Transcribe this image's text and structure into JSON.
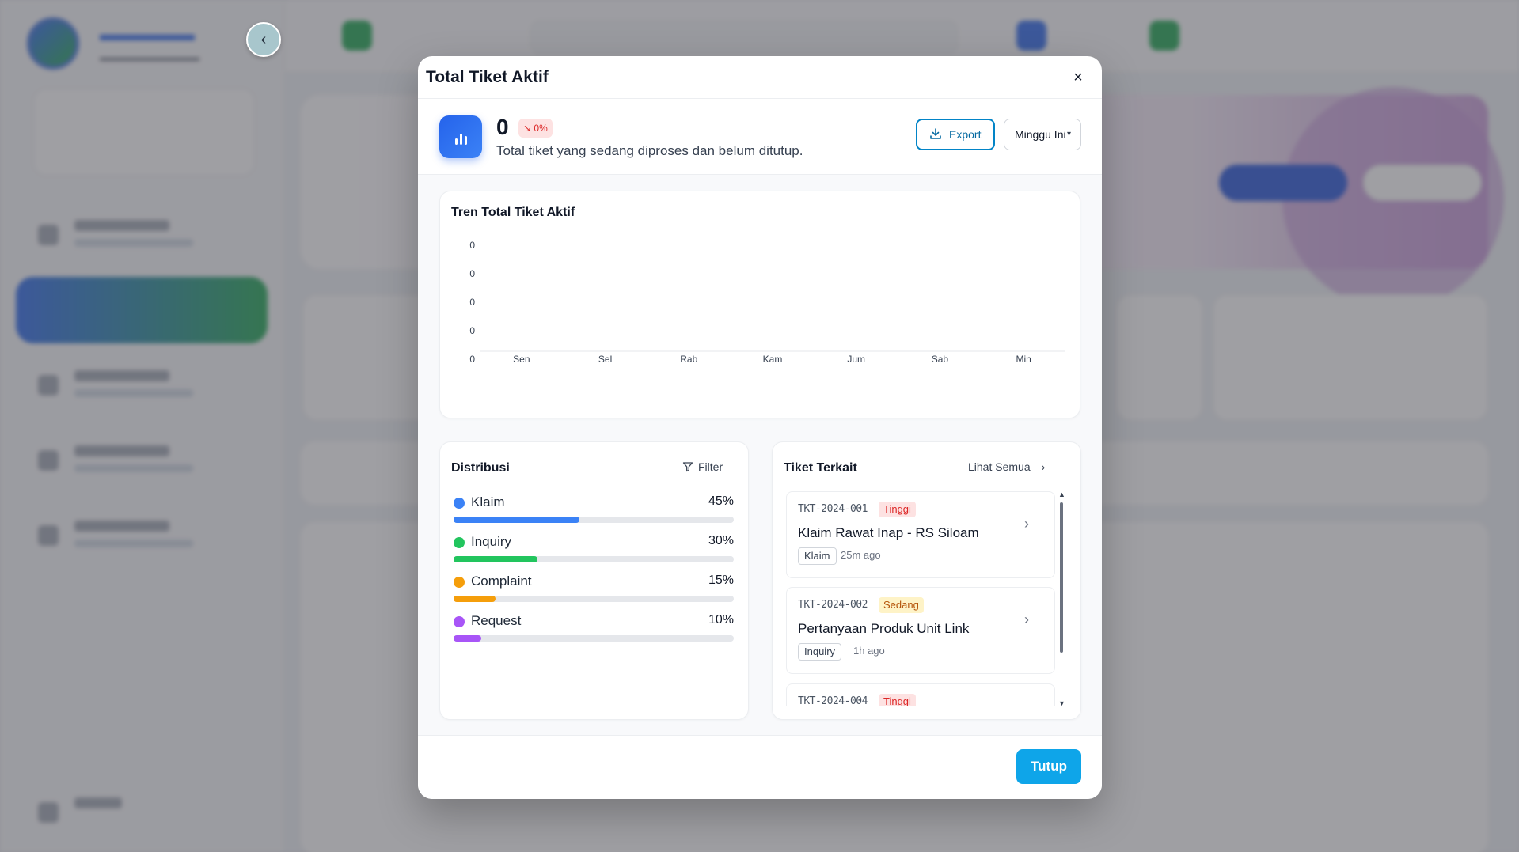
{
  "modal": {
    "title": "Total Tiket Aktif",
    "close_glyph": "×",
    "summary": {
      "value": "0",
      "change_badge": "↘ 0%",
      "description": "Total tiket yang sedang diproses dan belum ditutup.",
      "export_label": "Export",
      "period_label": "Minggu Ini"
    },
    "trend": {
      "title": "Tren Total Tiket Aktif"
    },
    "distribution": {
      "title": "Distribusi",
      "filter_label": "Filter",
      "items": [
        {
          "label": "Klaim",
          "percent": "45%",
          "value": 45,
          "color": "#3b82f6"
        },
        {
          "label": "Inquiry",
          "percent": "30%",
          "value": 30,
          "color": "#22c55e"
        },
        {
          "label": "Complaint",
          "percent": "15%",
          "value": 15,
          "color": "#f59e0b"
        },
        {
          "label": "Request",
          "percent": "10%",
          "value": 10,
          "color": "#a855f7"
        }
      ]
    },
    "related": {
      "title": "Tiket Terkait",
      "see_all_label": "Lihat Semua",
      "tickets": [
        {
          "id": "TKT-2024-001",
          "priority": "Tinggi",
          "title": "Klaim Rawat Inap - RS Siloam",
          "category": "Klaim",
          "ago": "25m ago"
        },
        {
          "id": "TKT-2024-002",
          "priority": "Sedang",
          "title": "Pertanyaan Produk Unit Link",
          "category": "Inquiry",
          "ago": "1h ago"
        },
        {
          "id": "TKT-2024-004",
          "priority": "Tinggi",
          "title": "",
          "category": "",
          "ago": ""
        }
      ]
    },
    "footer": {
      "close_label": "Tutup"
    }
  },
  "colors": {
    "accent": "#0ea5e9",
    "export_border": "#0284c7",
    "badge_red_bg": "#fde2e2",
    "badge_red_text": "#dc2626",
    "badge_yellow_bg": "#fef3c7",
    "badge_yellow_text": "#b45309"
  },
  "chart_data": {
    "type": "line",
    "title": "Tren Total Tiket Aktif",
    "categories": [
      "Sen",
      "Sel",
      "Rab",
      "Kam",
      "Jum",
      "Sab",
      "Min"
    ],
    "y_tick_labels": [
      "0",
      "0",
      "0",
      "0",
      "0"
    ],
    "series": [
      {
        "values": [
          0,
          0,
          0,
          0,
          0,
          0,
          0
        ]
      }
    ],
    "ylim": [
      0,
      0
    ],
    "grid": false,
    "legend": "none"
  }
}
